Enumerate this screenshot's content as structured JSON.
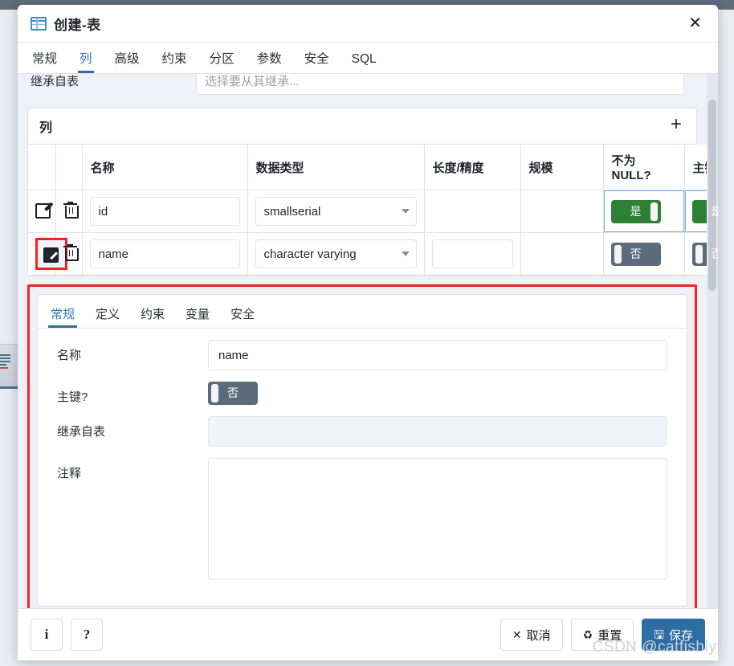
{
  "dialog": {
    "title": "创建-表",
    "title_icon": "table-icon",
    "close_icon": "close-icon",
    "tabs": [
      {
        "label": "常规",
        "active": false
      },
      {
        "label": "列",
        "active": true
      },
      {
        "label": "高级",
        "active": false
      },
      {
        "label": "约束",
        "active": false
      },
      {
        "label": "分区",
        "active": false
      },
      {
        "label": "参数",
        "active": false
      },
      {
        "label": "安全",
        "active": false
      },
      {
        "label": "SQL",
        "active": false
      }
    ]
  },
  "inherit_row": {
    "label": "继承自表",
    "placeholder": "选择要从其继承..."
  },
  "columns_panel": {
    "title": "列",
    "add_icon": "plus-icon",
    "headers": [
      "",
      "",
      "名称",
      "数据类型",
      "长度/精度",
      "规模",
      "不为 NULL?",
      "主键?"
    ],
    "rows": [
      {
        "edit_icon": "edit-icon",
        "delete_icon": "trash-icon",
        "name": "id",
        "datatype": "smallserial",
        "length": "",
        "scale": "",
        "not_null": "是",
        "not_null_on": true,
        "primary_key": "是",
        "primary_key_on": true,
        "has_length_input": false,
        "highlighted": false
      },
      {
        "edit_icon": "edit-icon",
        "delete_icon": "trash-icon",
        "name": "name",
        "datatype": "character varying",
        "length": "",
        "scale": "",
        "not_null": "否",
        "not_null_on": false,
        "primary_key": "否",
        "primary_key_on": false,
        "has_length_input": true,
        "highlighted": true
      }
    ]
  },
  "detail": {
    "tabs": [
      {
        "label": "常规",
        "active": true
      },
      {
        "label": "定义",
        "active": false
      },
      {
        "label": "约束",
        "active": false
      },
      {
        "label": "变量",
        "active": false
      },
      {
        "label": "安全",
        "active": false
      }
    ],
    "fields": {
      "name_label": "名称",
      "name_value": "name",
      "pk_label": "主键?",
      "pk_value": "否",
      "pk_on": false,
      "inherit_label": "继承自表",
      "inherit_value": "",
      "comment_label": "注释",
      "comment_value": ""
    }
  },
  "footer": {
    "info_label": "i",
    "help_label": "?",
    "cancel_label": "取消",
    "cancel_icon": "✕",
    "reset_label": "重置",
    "reset_icon": "♻",
    "save_label": "保存",
    "save_icon": "🖫"
  },
  "watermark": "CSDN @catfishlyf",
  "colors": {
    "accent": "#2e6da4",
    "toggle_on": "#2d8034",
    "toggle_off": "#5b6b7c",
    "highlight": "#fc1f1f",
    "topbar": "#5d6d7b"
  }
}
